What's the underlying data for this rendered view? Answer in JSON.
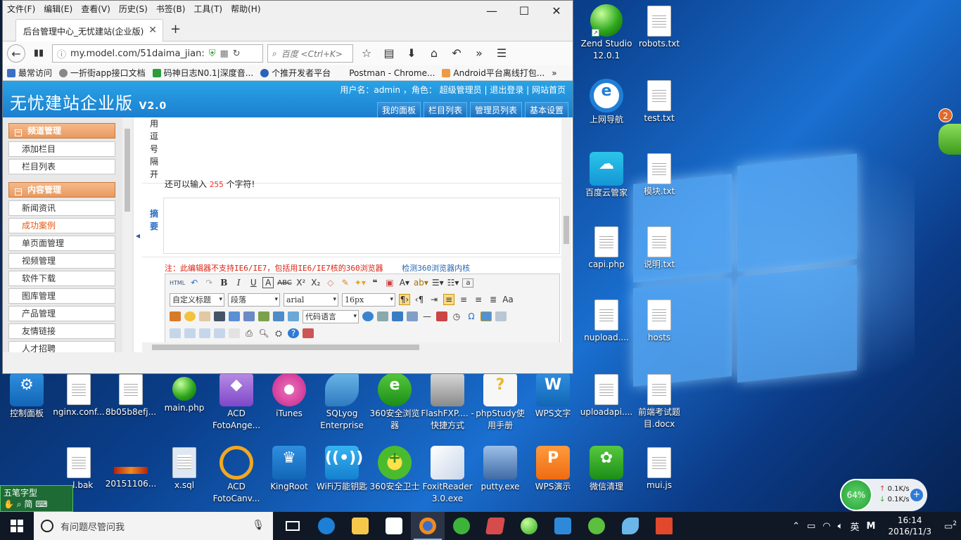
{
  "browser": {
    "menu": [
      "文件(F)",
      "编辑(E)",
      "查看(V)",
      "历史(S)",
      "书签(B)",
      "工具(T)",
      "帮助(H)"
    ],
    "tab_title": "后台管理中心_无忧建站(企业版)",
    "url": "my.model.com/51daima_jian:",
    "search_placeholder": "百度 <Ctrl+K>",
    "bookmarks": [
      "最常访问",
      "一折街app接口文档",
      "码神日志N0.1|深度音...",
      "个推开发者平台",
      "Postman - Chrome...",
      "Android平台离线打包..."
    ]
  },
  "site": {
    "logo": "无忧建站企业版",
    "version": "V2.0",
    "userinfo": "用户名：admin ，角色： 超级管理员 | 退出登录 | 网站首页",
    "topnav": [
      "我的面板",
      "栏目列表",
      "管理员列表",
      "基本设置"
    ],
    "sidebar": {
      "group1": "频道管理",
      "group1_items": [
        "添加栏目",
        "栏目列表"
      ],
      "group2": "内容管理",
      "group2_items": [
        "新闻资讯",
        "成功案例",
        "单页面管理",
        "视频管理",
        "软件下载",
        "图库管理",
        "产品管理",
        "友情链接",
        "人才招聘"
      ]
    },
    "form": {
      "tags_hint_chars": [
        "用",
        "逗",
        "号",
        "隔",
        "开"
      ],
      "summary_label_chars": [
        "摘",
        "要"
      ],
      "remaining_prefix": "还可以输入",
      "remaining_count": "255",
      "remaining_suffix": "个字符!",
      "editor_warning": "注：此编辑器不支持IE6/IE7，包括用IE6/IE7核的360浏览器",
      "detect_link": "检测360浏览器内核"
    },
    "editor": {
      "title_select": "自定义标题",
      "para_select": "段落",
      "font_select": "arial",
      "size_select": "16px",
      "code_select": "代码语言"
    }
  },
  "desktop": {
    "icons": [
      {
        "label": "Zend Studio 12.0.1",
        "icon": "zend-ball"
      },
      {
        "label": "robots.txt",
        "icon": "text-file"
      },
      {
        "label": "上网导航",
        "icon": "ie-icon"
      },
      {
        "label": "test.txt",
        "icon": "text-file"
      },
      {
        "label": "百度云管家",
        "icon": "baidu-cloud"
      },
      {
        "label": "模块.txt",
        "icon": "text-file"
      },
      {
        "label": "capi.php",
        "icon": "php-ball"
      },
      {
        "label": "说明.txt",
        "icon": "text-file"
      },
      {
        "label": "nupload....",
        "icon": "php-ball"
      },
      {
        "label": "hosts",
        "icon": "file"
      },
      {
        "label": "控制面板",
        "icon": "control-panel"
      },
      {
        "label": "nginx.conf...",
        "icon": "file"
      },
      {
        "label": "8b05b8efj...",
        "icon": "file"
      },
      {
        "label": "main.php",
        "icon": "php-ball"
      },
      {
        "label": "ACD FotoAnge...",
        "icon": "acd"
      },
      {
        "label": "iTunes",
        "icon": "itunes"
      },
      {
        "label": "SQLyog Enterprise",
        "icon": "sqlyog"
      },
      {
        "label": "360安全浏览器",
        "icon": "360-browser"
      },
      {
        "label": "FlashFXP.... - 快捷方式",
        "icon": "flashfxp"
      },
      {
        "label": "phpStudy使用手册",
        "icon": "phpstudy"
      },
      {
        "label": "WPS文字",
        "icon": "wps-writer"
      },
      {
        "label": "uploadapi....",
        "icon": "php-ball"
      },
      {
        "label": "前端考试题目.docx",
        "icon": "word-doc"
      },
      {
        "label": "...l.bak",
        "icon": "file"
      },
      {
        "label": "20151106...",
        "icon": "image"
      },
      {
        "label": "x.sql",
        "icon": "sql-file"
      },
      {
        "label": "ACD FotoCanv...",
        "icon": "acd"
      },
      {
        "label": "KingRoot",
        "icon": "kingroot"
      },
      {
        "label": "WiFi万能钥匙",
        "icon": "wifi"
      },
      {
        "label": "360安全卫士",
        "icon": "360-guard"
      },
      {
        "label": "FoxitReader 3.0.exe",
        "icon": "foxit"
      },
      {
        "label": "putty.exe",
        "icon": "putty"
      },
      {
        "label": "WPS演示",
        "icon": "wps-present"
      },
      {
        "label": "微信清理",
        "icon": "wechat-clean"
      },
      {
        "label": "mui.js",
        "icon": "js-file"
      }
    ],
    "badge_count": "2"
  },
  "ime": {
    "line1": "五笔字型",
    "line2": "简"
  },
  "network_widget": {
    "percent": "64%",
    "up": "0.1K/s",
    "down": "0.1K/s"
  },
  "taskbar": {
    "search_placeholder": "有问题尽管问我",
    "ime_lang": "英",
    "ime_mode": "M",
    "time": "16:14",
    "date": "2016/11/3",
    "notif_count": "2",
    "colors": {
      "taskbar_bg": "#101826",
      "accent": "#1b7fcf"
    }
  }
}
